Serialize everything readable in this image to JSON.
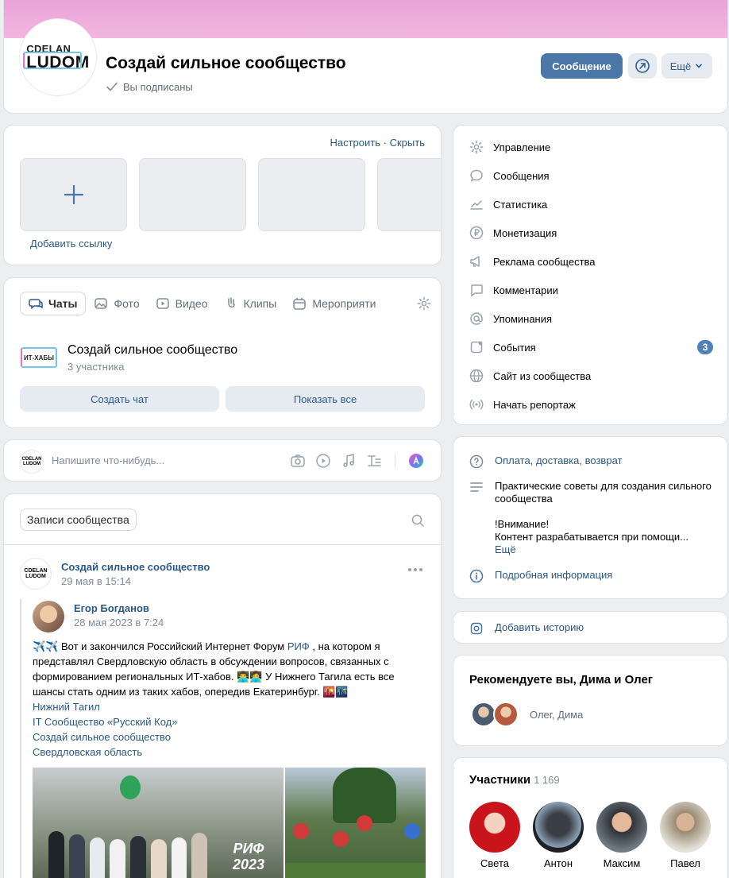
{
  "header": {
    "logo_line1": "CDELAN",
    "logo_line2": "LUDOM",
    "title": "Создай сильное сообщество",
    "subscribed": "Вы подписаны",
    "message_button": "Сообщение",
    "more_button": "Ещё"
  },
  "links": {
    "configure": "Настроить",
    "separator": "·",
    "hide": "Скрыть",
    "add_link": "Добавить ссылку"
  },
  "tabs": {
    "items": [
      {
        "label": "Чаты",
        "icon": "chat-icon"
      },
      {
        "label": "Фото",
        "icon": "photo-icon"
      },
      {
        "label": "Видео",
        "icon": "video-icon"
      },
      {
        "label": "Клипы",
        "icon": "clips-icon"
      },
      {
        "label": "Мероприяти",
        "icon": "events-icon"
      }
    ],
    "chat": {
      "avatar_label": "ИТ-ХАБЫ",
      "title": "Создай сильное сообщество",
      "subtitle": "3 участника"
    },
    "create_chat": "Создать чат",
    "show_all": "Показать все"
  },
  "composer": {
    "placeholder": "Напишите что-нибудь..."
  },
  "feed": {
    "posts_chip": "Записи сообщества",
    "post": {
      "author": "Создай сильное сообщество",
      "date": "29 мая в 15:14"
    },
    "repost": {
      "author": "Егор Богданов",
      "date": "28 мая 2023 в 7:24",
      "text_part1": "✈️✈️ Вот и закончился Российский Интернет Форум ",
      "text_link": "РИФ",
      "text_part2": " , на котором я представлял Свердловскую область в обсуждении вопросов, связанных с формированием региональных ИТ-хабов. 👨‍💻👩‍💻 У Нижнего Тагила есть все шансы стать одним из таких хабов, опередив Екатеринбург. 🌇🌃",
      "tags": [
        "Нижний Тагил",
        "IT Сообщество «Русский Код»",
        "Создай сильное сообщество",
        "Свердловская область"
      ],
      "photo_caption": "РИФ 2023"
    }
  },
  "menu": {
    "items": [
      {
        "label": "Управление",
        "icon": "gear-icon"
      },
      {
        "label": "Сообщения",
        "icon": "message-icon"
      },
      {
        "label": "Статистика",
        "icon": "stats-icon"
      },
      {
        "label": "Монетизация",
        "icon": "ruble-icon"
      },
      {
        "label": "Реклама сообщества",
        "icon": "megaphone-icon"
      },
      {
        "label": "Комментарии",
        "icon": "comment-icon"
      },
      {
        "label": "Упоминания",
        "icon": "at-icon"
      },
      {
        "label": "События",
        "icon": "events-icon",
        "badge": "3"
      },
      {
        "label": "Сайт из сообщества",
        "icon": "globe-icon"
      },
      {
        "label": "Начать репортаж",
        "icon": "broadcast-icon"
      }
    ]
  },
  "info": {
    "payment": "Оплата, доставка, возврат",
    "description": "Практические советы для создания сильного сообщества",
    "notice_line1": "!Внимание!",
    "notice_line2": "Контент разрабатывается при помощи...",
    "more": "Ещё",
    "details": "Подробная информация"
  },
  "story": {
    "label": "Добавить историю"
  },
  "recommend": {
    "title": "Рекомендуете вы, Дима и Олег",
    "names": "Олег, Дима"
  },
  "members": {
    "title": "Участники",
    "count": "1 169",
    "list": [
      {
        "name": "Света"
      },
      {
        "name": "Антон"
      },
      {
        "name": "Максим"
      },
      {
        "name": "Павел"
      }
    ]
  },
  "colors": {
    "accent": "#4a76a8",
    "link": "#2a5885",
    "cover_pink": "#e9a3d8",
    "badge": "#5181b8"
  }
}
